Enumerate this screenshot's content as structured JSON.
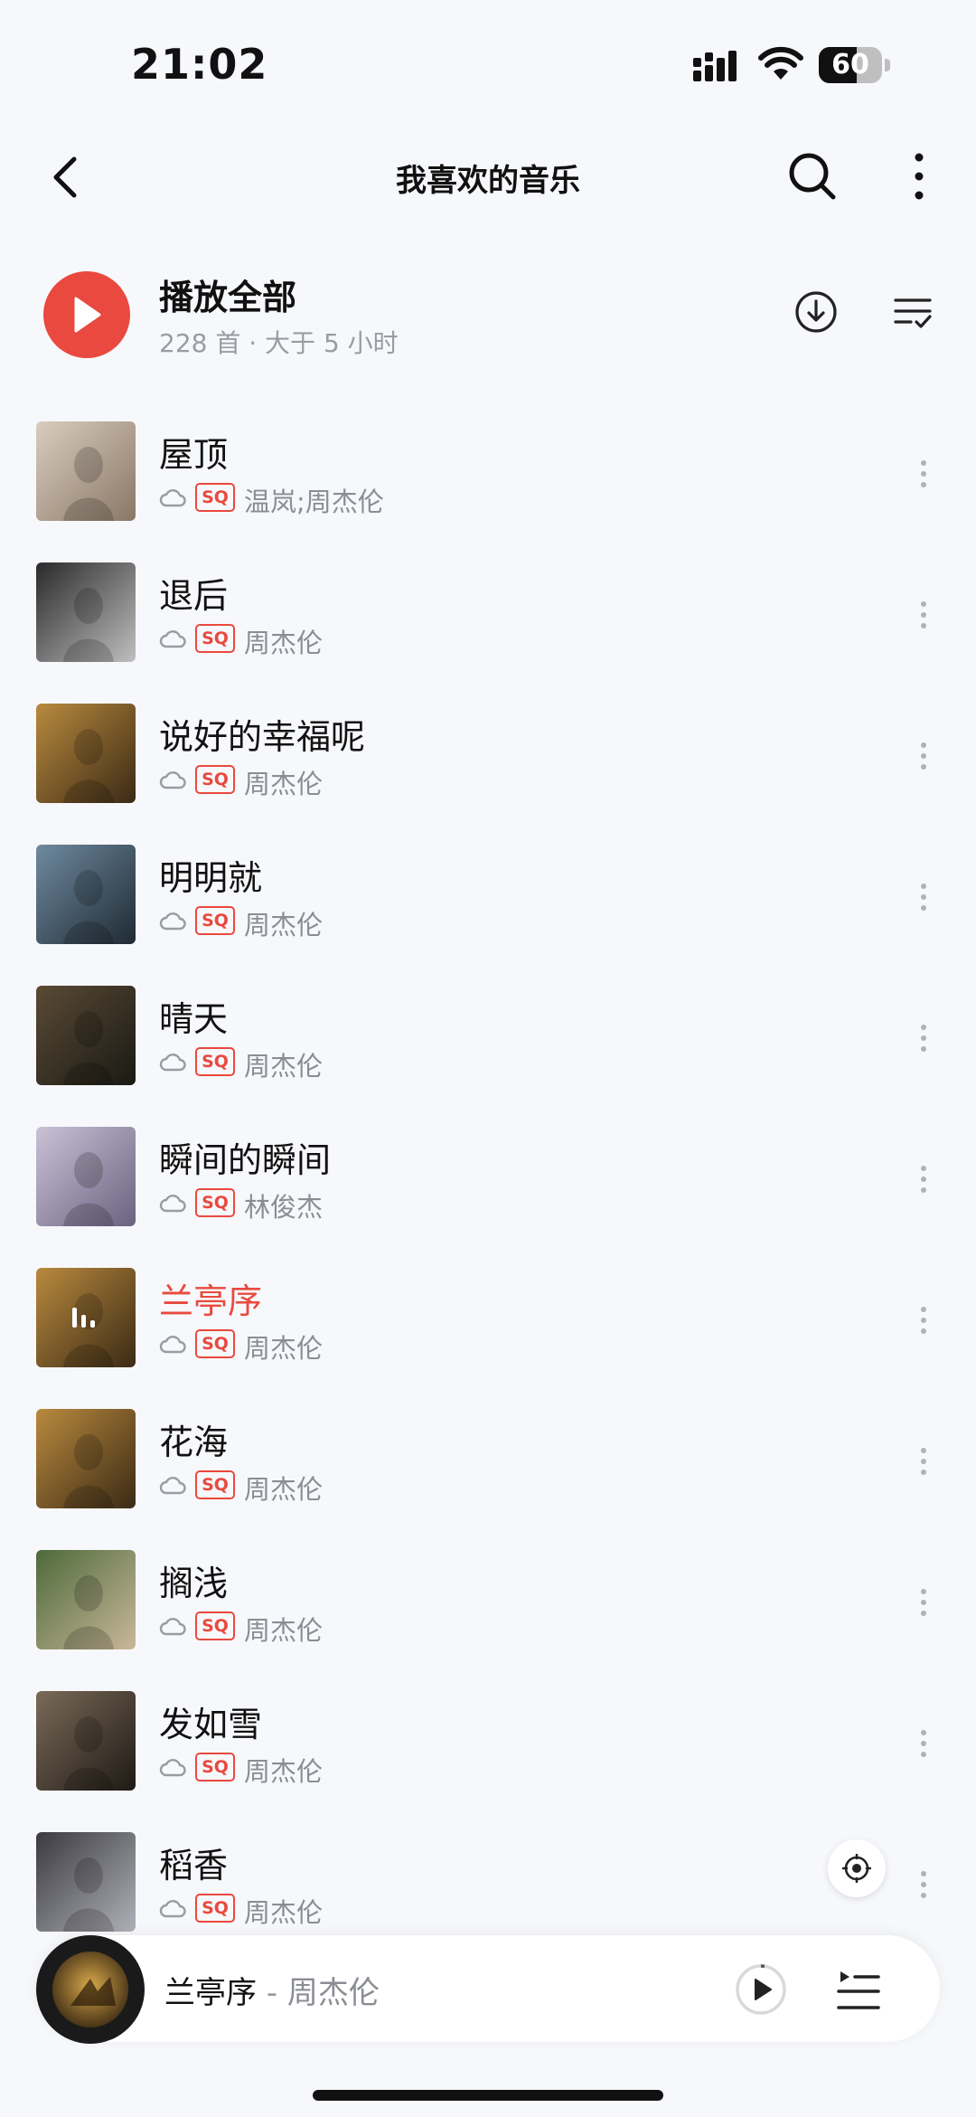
{
  "status_bar": {
    "time": "21:02",
    "battery": "60",
    "battery_level": 0.6
  },
  "header": {
    "title": "我喜欢的音乐",
    "icons": [
      "back-icon",
      "search-icon",
      "more-vertical-icon"
    ]
  },
  "play_all": {
    "label": "播放全部",
    "subtitle": "228 首 · 大于 5 小时",
    "icons": [
      "play-icon",
      "download-icon",
      "sort-list-icon"
    ]
  },
  "colors": {
    "accent": "#e9493f",
    "background": "#f7f8fb",
    "secondary_text": "#8a8d94"
  },
  "songs": [
    {
      "title": "屋顶",
      "quality": "SQ",
      "artist": "温岚;周杰伦",
      "playing": false
    },
    {
      "title": "退后",
      "quality": "SQ",
      "artist": "周杰伦",
      "playing": false
    },
    {
      "title": "说好的幸福呢",
      "quality": "SQ",
      "artist": "周杰伦",
      "playing": false
    },
    {
      "title": "明明就",
      "quality": "SQ",
      "artist": "周杰伦",
      "playing": false
    },
    {
      "title": "晴天",
      "quality": "SQ",
      "artist": "周杰伦",
      "playing": false
    },
    {
      "title": "瞬间的瞬间",
      "quality": "SQ",
      "artist": "林俊杰",
      "playing": false
    },
    {
      "title": "兰亭序",
      "quality": "SQ",
      "artist": "周杰伦",
      "playing": true
    },
    {
      "title": "花海",
      "quality": "SQ",
      "artist": "周杰伦",
      "playing": false
    },
    {
      "title": "搁浅",
      "quality": "SQ",
      "artist": "周杰伦",
      "playing": false
    },
    {
      "title": "发如雪",
      "quality": "SQ",
      "artist": "周杰伦",
      "playing": false
    },
    {
      "title": "稻香",
      "quality": "SQ",
      "artist": "周杰伦",
      "playing": false
    }
  ],
  "now_playing": {
    "title": "兰亭序",
    "separator": " - ",
    "artist": "周杰伦"
  }
}
